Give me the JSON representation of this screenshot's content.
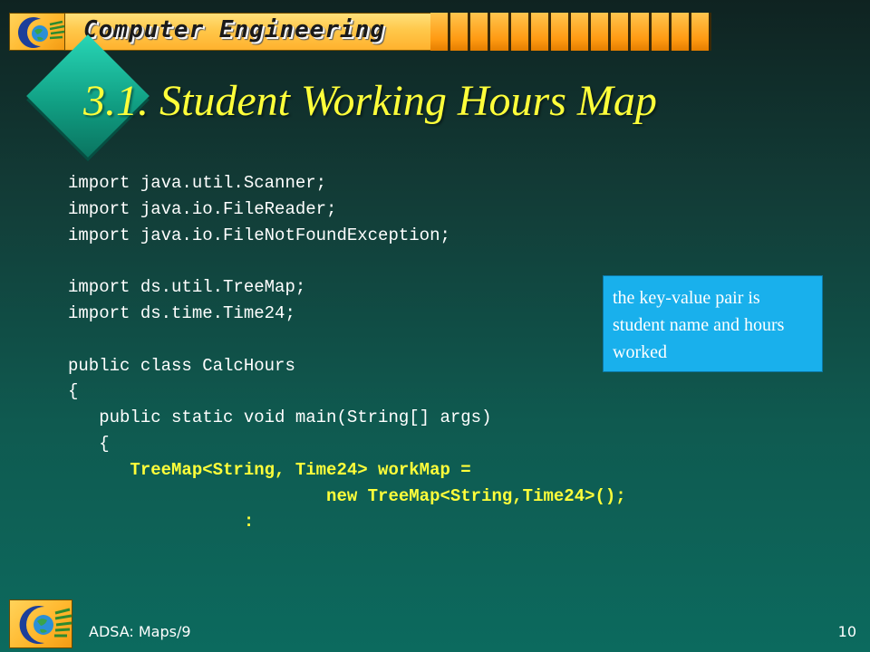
{
  "header": {
    "banner_title": "Computer Engineering"
  },
  "slide": {
    "title": "3.1.  Student Working Hours Map",
    "code_lines": [
      {
        "text": "import java.util.Scanner;",
        "highlight": false
      },
      {
        "text": "import java.io.FileReader;",
        "highlight": false
      },
      {
        "text": "import java.io.FileNotFoundException;",
        "highlight": false
      },
      {
        "text": "",
        "highlight": false
      },
      {
        "text": "import ds.util.TreeMap;",
        "highlight": false
      },
      {
        "text": "import ds.time.Time24;",
        "highlight": false
      },
      {
        "text": "",
        "highlight": false
      },
      {
        "text": "public class CalcHours",
        "highlight": false
      },
      {
        "text": "{",
        "highlight": false
      },
      {
        "text": "   public static void main(String[] args)",
        "highlight": false
      },
      {
        "text": "   {",
        "highlight": false
      },
      {
        "text": "      TreeMap<String, Time24> workMap =",
        "highlight": true
      },
      {
        "text": "                         new TreeMap<String,Time24>();",
        "highlight": true
      },
      {
        "text": "                 :",
        "highlight": true
      }
    ],
    "callout": "the key-value pair is student name and hours worked"
  },
  "footer": {
    "label": "ADSA: Maps/9",
    "page_number": "10"
  },
  "colors": {
    "title": "#ffff3a",
    "callout_bg": "#19b0ec",
    "banner": "#ffb22e",
    "background": "#0c6a5e"
  },
  "icons": {
    "banner_logo": "globe-icon",
    "footer_logo": "globe-icon",
    "bullet": "diamond-bullet-icon"
  }
}
